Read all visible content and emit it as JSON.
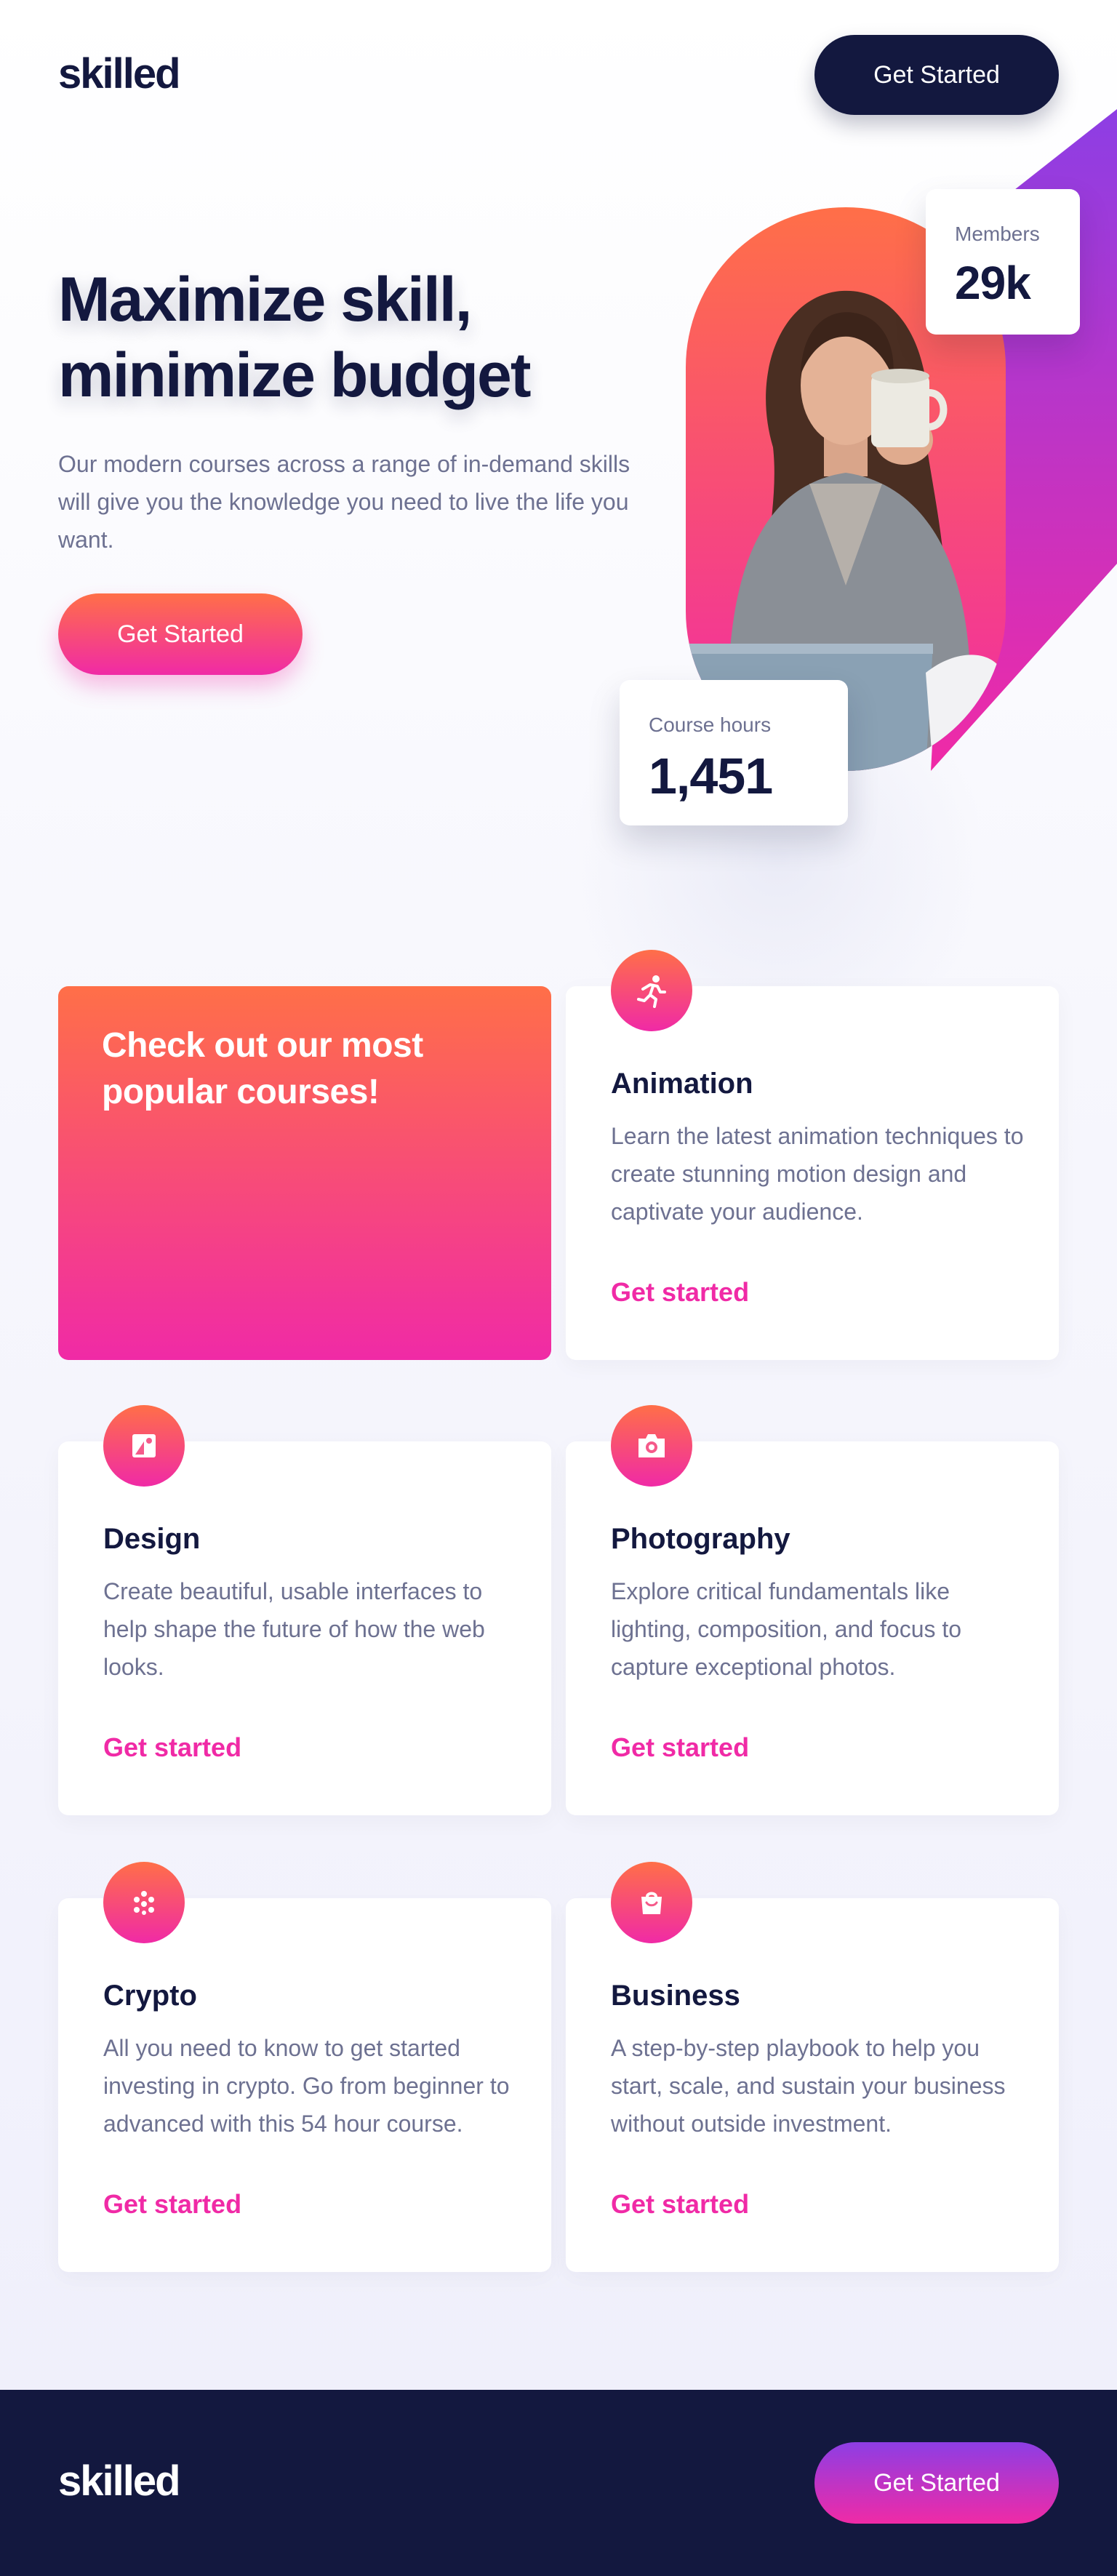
{
  "header": {
    "logo": "skilled",
    "cta_label": "Get Started"
  },
  "hero": {
    "title": "Maximize skill, minimize budget",
    "description": "Our modern courses across a range of in-demand skills will give you the knowledge you need to live the life you want.",
    "cta_label": "Get Started",
    "stats": {
      "members_label": "Members",
      "members_value": "29k",
      "hours_label": "Course hours",
      "hours_value": "1,451"
    }
  },
  "promo": {
    "title": "Check out our most popular courses!"
  },
  "courses": [
    {
      "icon": "running-figure-icon",
      "title": "Animation",
      "description": "Learn the latest animation techniques to create stunning motion design and captivate your audience.",
      "link": "Get started"
    },
    {
      "icon": "design-icon",
      "title": "Design",
      "description": "Create beautiful, usable interfaces to help shape the future of how the web looks.",
      "link": "Get started"
    },
    {
      "icon": "camera-icon",
      "title": "Photography",
      "description": "Explore critical fundamentals like lighting, composition, and focus to capture exceptional photos.",
      "link": "Get started"
    },
    {
      "icon": "crypto-icon",
      "title": "Crypto",
      "description": "All you need to know to get started investing in crypto. Go from beginner to advanced with this 54 hour course.",
      "link": "Get started"
    },
    {
      "icon": "briefcase-icon",
      "title": "Business",
      "description": "A step-by-step playbook to help you start, scale, and sustain your business without outside investment.",
      "link": "Get started"
    }
  ],
  "footer": {
    "logo": "skilled",
    "cta_label": "Get Started"
  },
  "colors": {
    "navy": "#13183f",
    "gray_text": "#6d7191",
    "pink": "#f02aa6",
    "orange": "#ff6f48",
    "purple": "#8d3ee4"
  }
}
